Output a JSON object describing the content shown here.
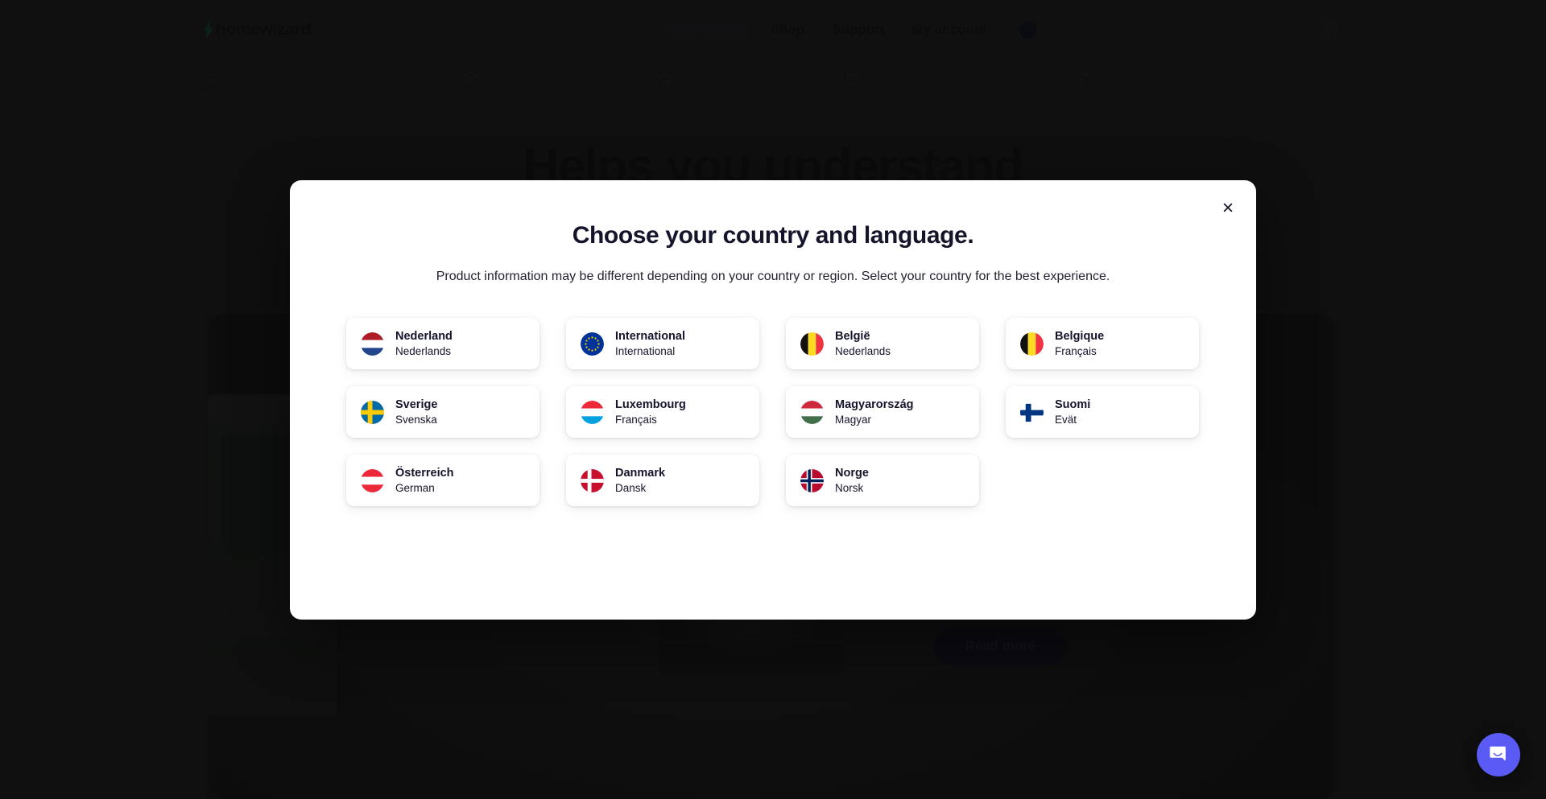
{
  "site": {
    "logo_text": "homewizard",
    "nav": [
      {
        "label": "Information",
        "active": true
      },
      {
        "label": "Shop",
        "active": false
      },
      {
        "label": "Support",
        "active": false
      },
      {
        "label": "My account",
        "active": false
      }
    ],
    "region_flag_icon": "region-flag-icon",
    "cart_icon": "shopping-cart-icon"
  },
  "usp_bar": [
    {
      "icon": "home-icon",
      "text": "Ordered before 11 PM, shipped ",
      "bold": "today",
      "tail": ""
    },
    {
      "icon": "box-icon",
      "text": "",
      "bold": "Free shipping",
      "tail": " from €75"
    },
    {
      "icon": "star-icon",
      "text": "Customer review 4.7/5",
      "bold": "",
      "tail": ""
    },
    {
      "icon": "calendar-icon",
      "text": "30-day ",
      "bold": "money back",
      "tail": " guarantee"
    },
    {
      "icon": "leaf-icon",
      "text": "Save on ",
      "bold": "energy",
      "tail": ""
    }
  ],
  "hero": {
    "title": "Helps you understand",
    "read_more_label": "Read more"
  },
  "modal": {
    "title": "Choose your country and language.",
    "subtitle": "Product information may be different depending on your country or region. Select your country for the best experience.",
    "close_icon": "close-icon",
    "countries": [
      {
        "country": "Nederland",
        "language": "Nederlands",
        "flag": "nl"
      },
      {
        "country": "International",
        "language": "International",
        "flag": "eu"
      },
      {
        "country": "België",
        "language": "Nederlands",
        "flag": "be"
      },
      {
        "country": "Belgique",
        "language": "Français",
        "flag": "be"
      },
      {
        "country": "Sverige",
        "language": "Svenska",
        "flag": "se"
      },
      {
        "country": "Luxembourg",
        "language": "Français",
        "flag": "lu"
      },
      {
        "country": "Magyarország",
        "language": "Magyar",
        "flag": "hu"
      },
      {
        "country": "Suomi",
        "language": "Evät",
        "flag": "fi"
      },
      {
        "country": "Österreich",
        "language": "German",
        "flag": "at"
      },
      {
        "country": "Danmark",
        "language": "Dansk",
        "flag": "dk"
      },
      {
        "country": "Norge",
        "language": "Norsk",
        "flag": "no"
      }
    ]
  },
  "chat": {
    "launcher_icon": "chat-bubble-icon"
  },
  "colors": {
    "accent": "#5a5af5",
    "modal_bg": "#ffffff",
    "text_dark": "#14142b",
    "nav_active": "#28284a",
    "read_more_bg": "#10122c"
  }
}
